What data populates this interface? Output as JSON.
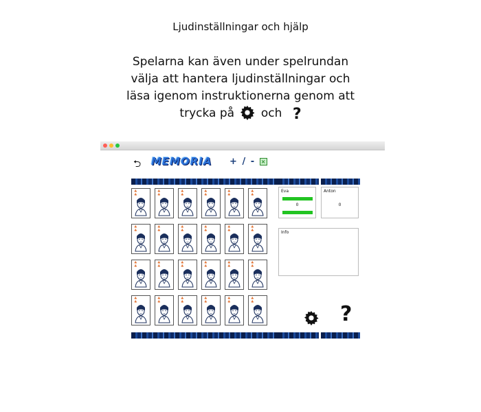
{
  "intro": {
    "title": "Ljudinställningar och hjälp",
    "line1": "Spelarna kan även under spelrundan",
    "line2": "välja att hantera ljudinställningar och",
    "line3": "läsa igenom instruktionerna genom att",
    "line4_before": "trycka på",
    "line4_after": "och",
    "question_glyph": "?"
  },
  "toolbar": {
    "back_glyph": "⮌",
    "logo": "MEMORIA",
    "plus": "+",
    "slash": "/",
    "minus": "-",
    "close_glyph": "×"
  },
  "players": [
    {
      "name": "Eva",
      "score": "0"
    },
    {
      "name": "Anton",
      "score": "0"
    }
  ],
  "info": {
    "label": "Info"
  },
  "help": {
    "glyph": "?"
  },
  "icons": [
    "back-icon",
    "gear-icon",
    "question-icon"
  ],
  "colors": {
    "logo": "#2a6fd6",
    "score_bar": "#22c422",
    "banner": "#0a1f4d"
  }
}
